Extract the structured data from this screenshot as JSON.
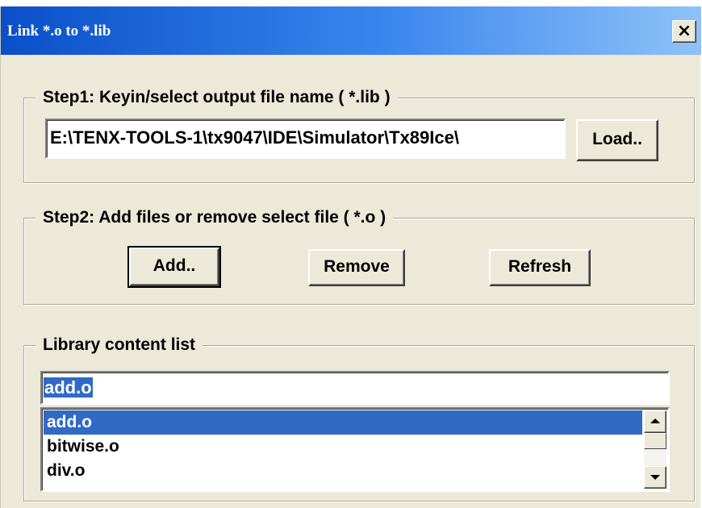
{
  "window": {
    "title": "Link *.o to *.lib",
    "close_label": "×"
  },
  "step1": {
    "legend": "Step1: Keyin/select output file name ( *.lib )",
    "path_value": "E:\\TENX-TOOLS-1\\tx9047\\IDE\\Simulator\\Tx89Ice\\",
    "load_label": "Load.."
  },
  "step2": {
    "legend": "Step2: Add files or remove select file ( *.o )",
    "add_label": "Add..",
    "remove_label": "Remove",
    "refresh_label": "Refresh"
  },
  "library": {
    "legend": "Library content list",
    "combo_value": "add.o",
    "items": [
      {
        "label": "add.o",
        "selected": true
      },
      {
        "label": "bitwise.o",
        "selected": false
      },
      {
        "label": "div.o",
        "selected": false
      }
    ]
  },
  "colors": {
    "title_gradient_start": "#0a4fc9",
    "selection": "#316ac5",
    "dialog_bg": "#ece9d8"
  },
  "icons": {
    "close": "close-icon",
    "scroll_up": "scroll-up-arrow-icon",
    "scroll_down": "scroll-down-arrow-icon"
  }
}
